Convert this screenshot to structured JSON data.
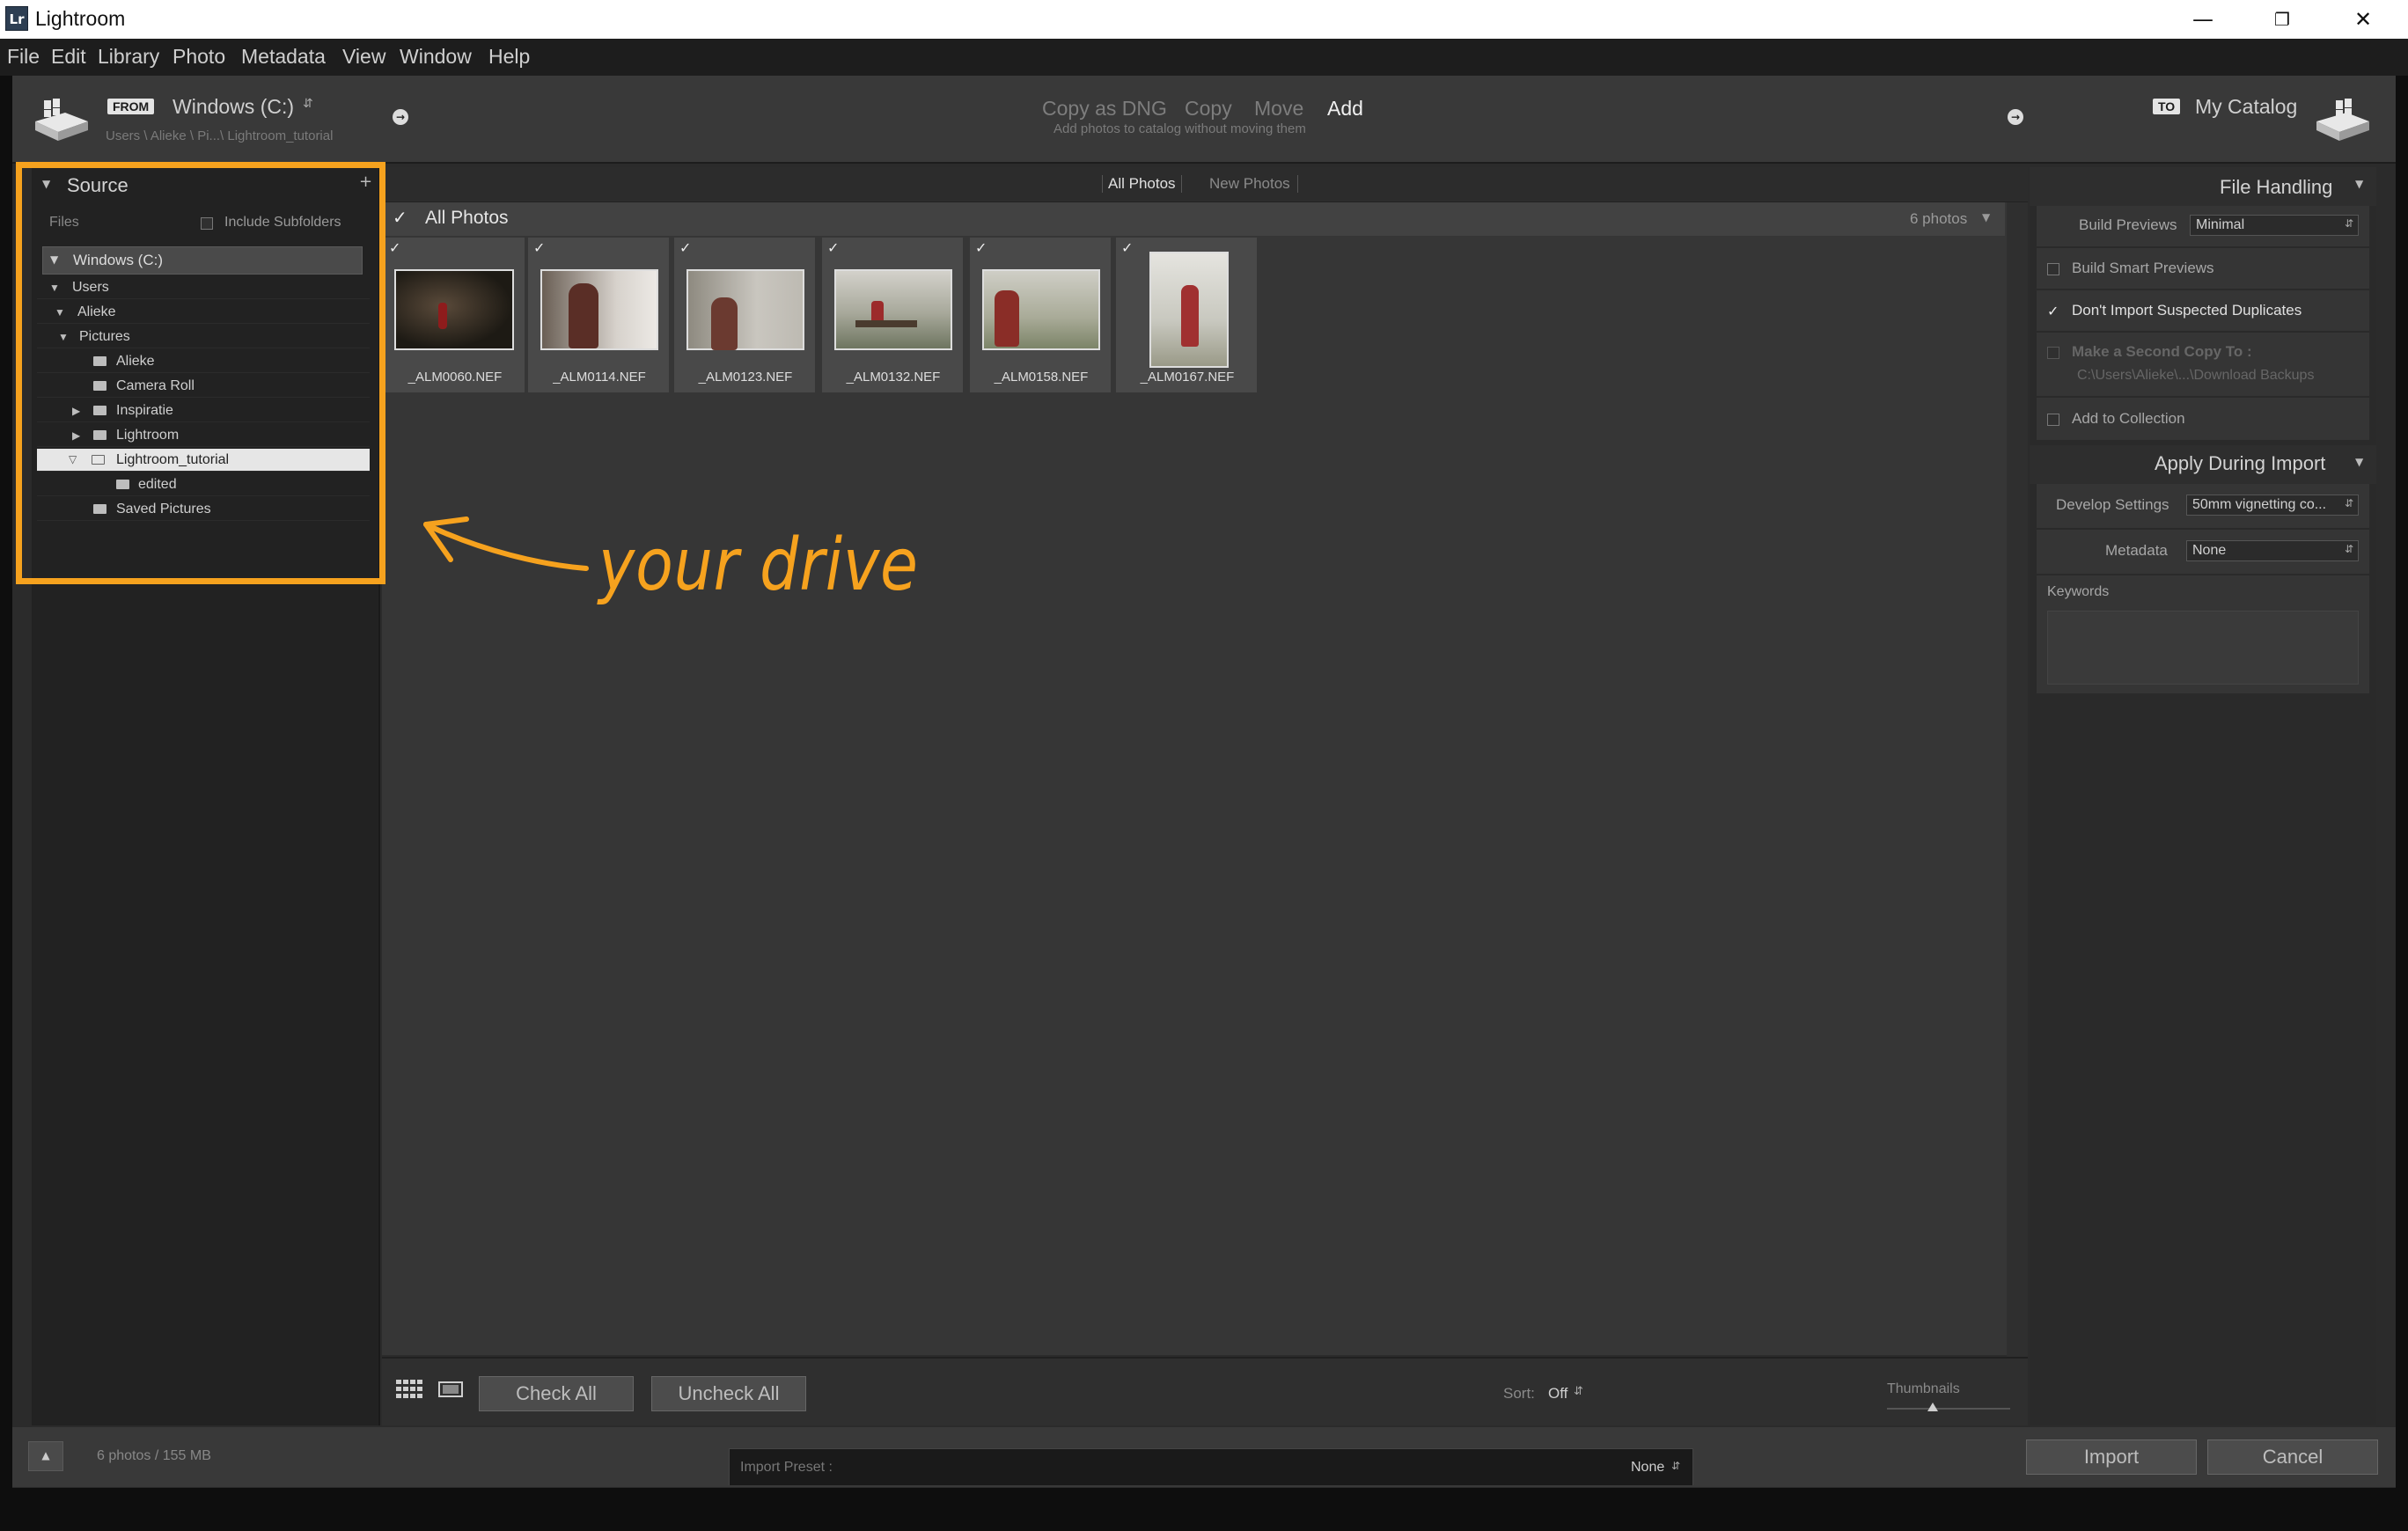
{
  "window": {
    "title": "Lightroom",
    "logo": "Lr",
    "controls": [
      "minimize-icon",
      "restore-icon",
      "close-icon"
    ]
  },
  "menu": [
    "File",
    "Edit",
    "Library",
    "Photo",
    "Metadata",
    "View",
    "Window",
    "Help"
  ],
  "import_header": {
    "from_badge": "FROM",
    "source_name": "Windows (C:)",
    "source_path": "Users \\ Alieke \\ Pi...\\ Lightroom_tutorial",
    "modes": [
      "Copy as DNG",
      "Copy",
      "Move",
      "Add"
    ],
    "active_mode": "Add",
    "mode_description": "Add photos to catalog without moving them",
    "to_badge": "TO",
    "destination": "My Catalog"
  },
  "source_panel": {
    "title": "Source",
    "add_icon": "+",
    "files_label": "Files",
    "include_subfolders": "Include Subfolders",
    "drive": "Windows (C:)",
    "tree": [
      "Users",
      "Alieke",
      "Pictures",
      "Alieke",
      "Camera Roll",
      "Inspiratie",
      "Lightroom",
      "Lightroom_tutorial",
      "edited",
      "Saved Pictures"
    ],
    "selected_folder": "Lightroom_tutorial"
  },
  "grid": {
    "tabs": [
      "All Photos",
      "New Photos"
    ],
    "active_tab": "All Photos",
    "header_title": "All Photos",
    "photo_count": "6 photos",
    "photos": [
      "_ALM0060.NEF",
      "_ALM0114.NEF",
      "_ALM0123.NEF",
      "_ALM0132.NEF",
      "_ALM0158.NEF",
      "_ALM0167.NEF"
    ]
  },
  "toolbar": {
    "check_all": "Check All",
    "uncheck_all": "Uncheck All",
    "sort_label": "Sort:",
    "sort_value": "Off",
    "thumbnails_label": "Thumbnails"
  },
  "right_panel": {
    "file_handling": "File Handling",
    "build_previews_label": "Build Previews",
    "build_previews_value": "Minimal",
    "build_smart_previews": "Build Smart Previews",
    "dont_import_duplicates": "Don't Import Suspected Duplicates",
    "make_second_copy": "Make a Second Copy To :",
    "second_copy_path": "C:\\Users\\Alieke\\...\\Download Backups",
    "add_to_collection": "Add to Collection",
    "apply_during_import": "Apply During Import",
    "develop_settings_label": "Develop Settings",
    "develop_settings_value": "50mm vignetting co...",
    "metadata_label": "Metadata",
    "metadata_value": "None",
    "keywords_label": "Keywords"
  },
  "footer": {
    "summary": "6 photos / 155 MB",
    "import_preset_label": "Import Preset :",
    "import_preset_value": "None",
    "import_button": "Import",
    "cancel_button": "Cancel"
  },
  "annotation": {
    "text": "your drive",
    "color": "#f6a21e"
  }
}
